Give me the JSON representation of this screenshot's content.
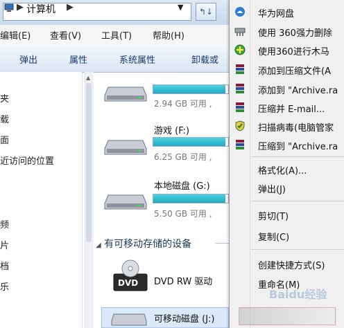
{
  "address": {
    "location": "计算机",
    "arrow": "▶",
    "dropdown": "▼",
    "nav": "↰↓"
  },
  "menubar": [
    {
      "label": "编辑(E)"
    },
    {
      "label": "查看(V)"
    },
    {
      "label": "工具(T)"
    },
    {
      "label": "帮助(H)"
    }
  ],
  "toolbar": [
    {
      "label": "弹出"
    },
    {
      "label": "属性"
    },
    {
      "label": "系统属性"
    },
    {
      "label": "卸载或"
    }
  ],
  "nav_pane": [
    {
      "label": "夹"
    },
    {
      "label": "载"
    },
    {
      "label": "面"
    },
    {
      "label": "近访问的位置"
    },
    {
      "label": "频"
    },
    {
      "label": "片"
    },
    {
      "label": "档"
    },
    {
      "label": "乐"
    }
  ],
  "drives": [
    {
      "name": "",
      "size": "2.94 GB 可用 ,",
      "used_fraction": 0.96
    },
    {
      "name": "游戏 (F:)",
      "size": "6.25 GB 可用 ,",
      "used_fraction": 0.96
    },
    {
      "name": "本地磁盘 (G:)",
      "size": "5.50 GB 可用 ,",
      "used_fraction": 0.96
    }
  ],
  "section_header": {
    "arrow": "◢",
    "label": "有可移动存储的设备"
  },
  "dvd": {
    "name": "DVD RW 驱动"
  },
  "removable": {
    "name": "可移动磁盘 (J:)"
  },
  "context_menu": {
    "items": [
      {
        "label": "华为网盘",
        "icon": "huawei-cloud-icon"
      },
      {
        "label": "使用 360强力删除",
        "icon": "shredder-icon"
      },
      {
        "label": "使用360进行木马",
        "icon": "360-shield-icon"
      },
      {
        "label": "添加到压缩文件(A",
        "icon": "winrar-icon"
      },
      {
        "label": "添加到 \"Archive.ra",
        "icon": "winrar-icon"
      },
      {
        "label": "压缩并 E-mail...",
        "icon": "winrar-icon"
      },
      {
        "label": "扫描病毒(电脑管家",
        "icon": "antivirus-shield-icon"
      },
      {
        "label": "压缩到 \"Archive.ra",
        "icon": "winrar-icon"
      },
      {
        "label": "格式化(A)...",
        "icon": ""
      },
      {
        "label": "弹出(J)",
        "icon": ""
      },
      {
        "label": "剪切(T)",
        "icon": ""
      },
      {
        "label": "复制(C)",
        "icon": ""
      },
      {
        "label": "创建快捷方式(S)",
        "icon": ""
      },
      {
        "label": "重命名(M)",
        "icon": ""
      }
    ]
  },
  "watermark": "Baidu经验",
  "colors": {
    "drive_bar": "#22a9c2",
    "selection": "#dbe9f8",
    "menu_bg": "#f0f0f0"
  }
}
